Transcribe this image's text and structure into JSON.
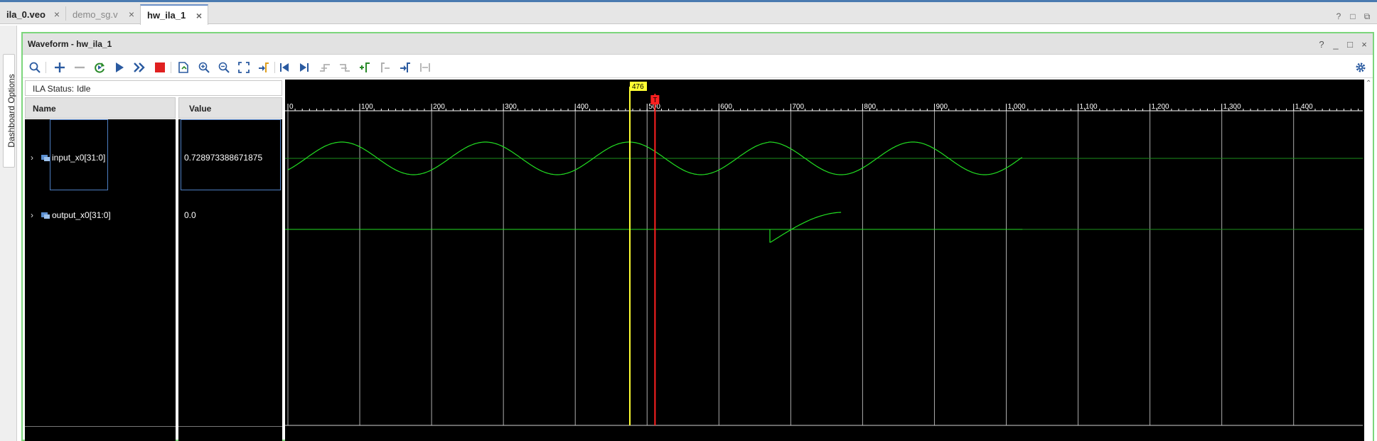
{
  "tabs": [
    {
      "label": "ila_0.veo",
      "state": "inactive-bold"
    },
    {
      "label": "demo_sg.v",
      "state": "inactive"
    },
    {
      "label": "hw_ila_1",
      "state": "active"
    }
  ],
  "tab_close_glyph": "×",
  "window_controls": [
    "?",
    "□",
    "⧉"
  ],
  "side_tab": {
    "label": "Dashboard Options"
  },
  "panel": {
    "title": "Waveform - hw_ila_1",
    "controls": [
      "?",
      "_",
      "□",
      "×"
    ]
  },
  "toolbar": {
    "buttons": [
      "search-icon",
      "add-icon",
      "remove-icon",
      "refresh-run-icon",
      "run-trigger-icon",
      "run-immediate-icon",
      "stop-icon",
      "export-icon",
      "zoom-in-icon",
      "zoom-out-icon",
      "zoom-fit-icon",
      "go-to-cursor-icon",
      "go-to-first-icon",
      "go-to-last-icon",
      "previous-transition-icon",
      "next-transition-icon",
      "add-marker-icon",
      "previous-marker-icon",
      "next-marker-icon",
      "swap-cursors-icon",
      "settings-gear-icon"
    ]
  },
  "ila_status": {
    "label": "ILA Status:",
    "value": "Idle"
  },
  "columns": {
    "name": "Name",
    "value": "Value"
  },
  "signals": [
    {
      "name": "input_x0[31:0]",
      "value": "0.728973388671875",
      "expanded": false
    },
    {
      "name": "output_x0[31:0]",
      "value": "0.0",
      "expanded": false
    }
  ],
  "timeline": {
    "ticks": [
      "0",
      "100",
      "200",
      "300",
      "400",
      "500",
      "600",
      "700",
      "800",
      "900",
      "1,000",
      "1,100",
      "1,200",
      "1,300",
      "1,400"
    ],
    "range": [
      0,
      1500
    ],
    "cursor": {
      "label": "476",
      "sample": 476,
      "color": "#ffff33"
    },
    "trigger": {
      "label": "T",
      "sample": 511,
      "color": "#ff2020"
    },
    "data_end_sample": 1023
  },
  "colors": {
    "waveform": "#22dd22",
    "baseline": "#1d8f1d",
    "grid": "#cccccc",
    "panel_border": "#7cd67c",
    "stop_button": "#e02020",
    "toolbar_icon": "#2a5aa0"
  }
}
